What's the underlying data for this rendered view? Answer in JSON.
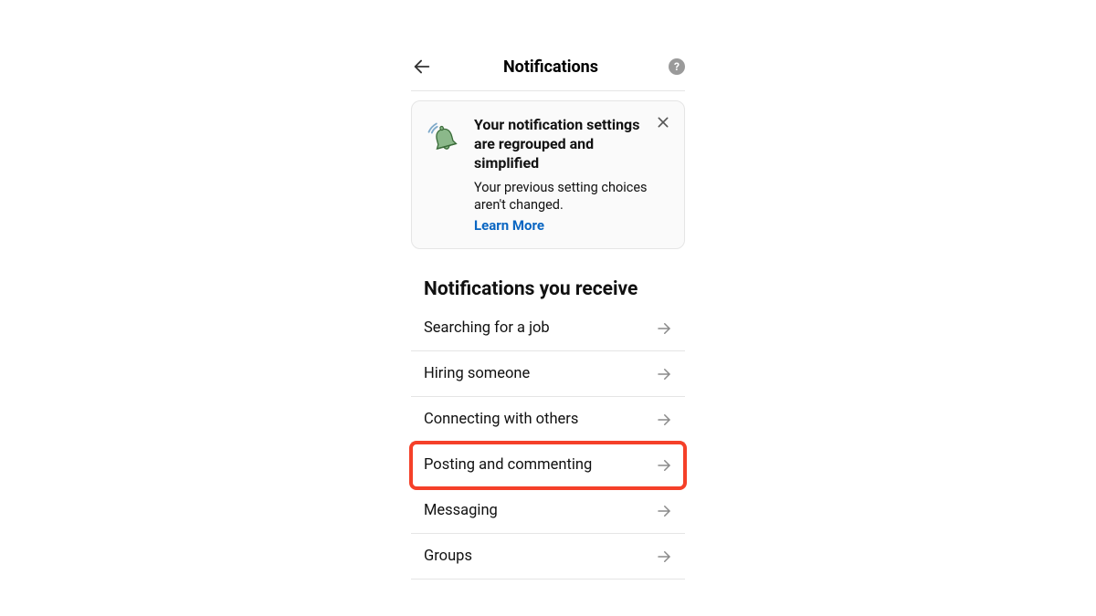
{
  "header": {
    "title": "Notifications"
  },
  "banner": {
    "title": "Your notification settings are regrouped and simplified",
    "text": "Your previous setting choices aren't changed.",
    "link": "Learn More"
  },
  "section": {
    "title": "Notifications you receive"
  },
  "items": [
    {
      "label": "Searching for a job"
    },
    {
      "label": "Hiring someone"
    },
    {
      "label": "Connecting with others"
    },
    {
      "label": "Posting and commenting"
    },
    {
      "label": "Messaging"
    },
    {
      "label": "Groups"
    }
  ],
  "highlighted_index": 3
}
